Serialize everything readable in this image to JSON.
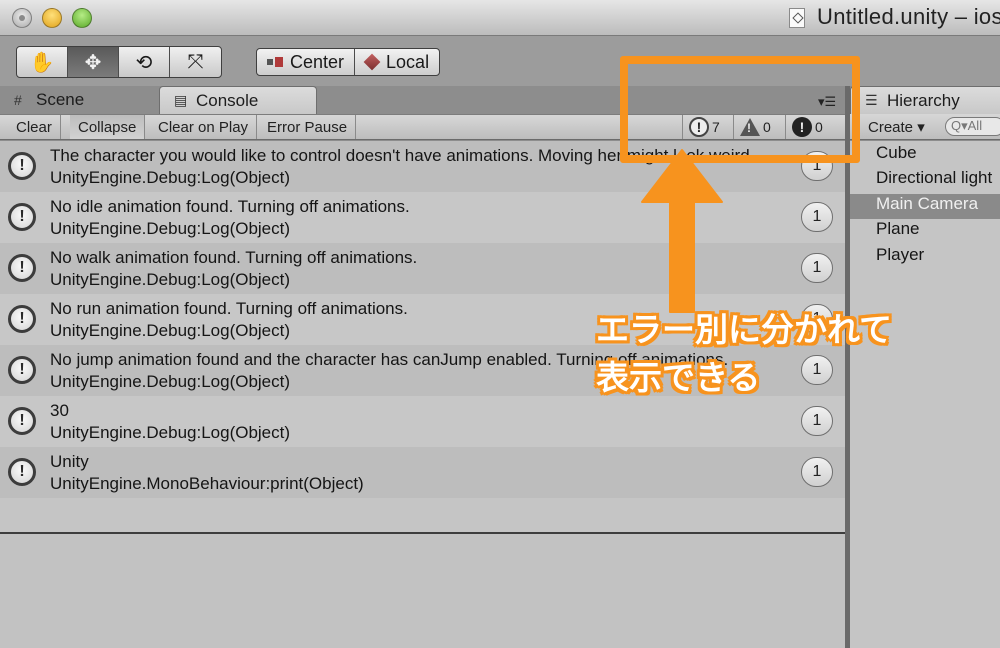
{
  "window": {
    "title": "Untitled.unity – ios"
  },
  "toolbar": {
    "transform_tools": [
      {
        "name": "hand-tool",
        "glyph": "✋",
        "active": false
      },
      {
        "name": "move-tool",
        "glyph": "✥",
        "active": true
      },
      {
        "name": "rotate-tool",
        "glyph": "⟲",
        "active": false
      },
      {
        "name": "scale-tool",
        "glyph": "⤧",
        "active": false
      }
    ],
    "pivot_label": "Center",
    "space_label": "Local"
  },
  "tabs": {
    "scene": "Scene",
    "console": "Console",
    "hierarchy": "Hierarchy"
  },
  "console_toolbar": {
    "clear": "Clear",
    "collapse": "Collapse",
    "clear_on_play": "Clear on Play",
    "error_pause": "Error Pause",
    "info_count": "7",
    "warning_count": "0",
    "error_count": "0"
  },
  "logs": [
    {
      "line1": "The character you would like to control doesn't have animations. Moving her might look weird",
      "line2": "UnityEngine.Debug:Log(Object)",
      "count": "1"
    },
    {
      "line1": "No idle animation found. Turning off animations.",
      "line2": "UnityEngine.Debug:Log(Object)",
      "count": "1"
    },
    {
      "line1": "No walk animation found. Turning off animations.",
      "line2": "UnityEngine.Debug:Log(Object)",
      "count": "1"
    },
    {
      "line1": "No run animation found. Turning off animations.",
      "line2": "UnityEngine.Debug:Log(Object)",
      "count": "1"
    },
    {
      "line1": "No jump animation found and the character has canJump enabled. Turning off animations.",
      "line2": "UnityEngine.Debug:Log(Object)",
      "count": "1"
    },
    {
      "line1": "30",
      "line2": "UnityEngine.Debug:Log(Object)",
      "count": "1"
    },
    {
      "line1": "Unity",
      "line2": "UnityEngine.MonoBehaviour:print(Object)",
      "count": "1"
    }
  ],
  "hierarchy": {
    "create_label": "Create ▾",
    "search_placeholder": "Q▾All",
    "items": [
      "Cube",
      "Directional light",
      "Main Camera",
      "Plane",
      "Player"
    ],
    "selected_index": 2
  },
  "annotation": {
    "line1": "エラー別に分かれて",
    "line2": "表示できる",
    "color": "#f7931e"
  }
}
